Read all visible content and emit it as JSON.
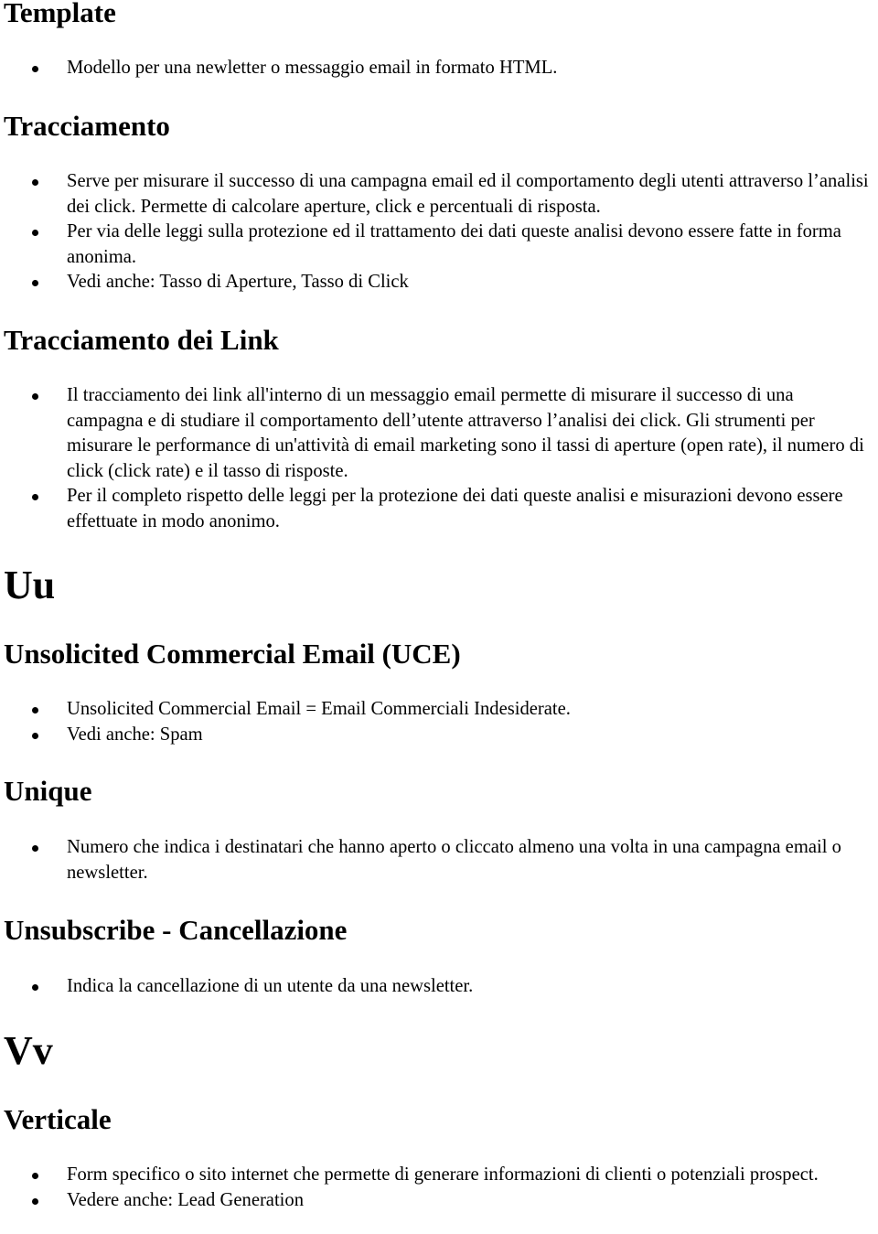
{
  "sections": [
    {
      "heading": "Template",
      "items": [
        "Modello per una newletter o messaggio email in formato HTML."
      ]
    },
    {
      "heading": "Tracciamento",
      "items": [
        "Serve per misurare il successo di una campagna email ed il comportamento degli utenti attraverso l’analisi dei click. Permette di calcolare aperture, click e percentuali di risposta.",
        "Per via delle leggi sulla protezione ed il trattamento dei dati queste analisi devono essere fatte in forma anonima.",
        "Vedi anche: Tasso di Aperture, Tasso di Click"
      ]
    },
    {
      "heading": "Tracciamento dei Link",
      "items": [
        "Il tracciamento dei link all'interno di un messaggio email permette di  misurare il successo di una campagna e di studiare il comportamento dell’utente attraverso l’analisi dei click. Gli strumenti per misurare le performance di un'attività di email marketing sono il tassi di aperture (open rate), il numero di click (click rate) e il tasso di risposte.",
        "Per il completo rispetto delle leggi per la protezione dei dati queste analisi e misurazioni devono essere effettuate in modo anonimo."
      ]
    },
    {
      "letter": "Uu"
    },
    {
      "heading": "Unsolicited Commercial Email (UCE)",
      "items": [
        "Unsolicited Commercial Email = Email Commerciali Indesiderate.",
        "Vedi anche: Spam"
      ]
    },
    {
      "heading": "Unique",
      "items": [
        "Numero che indica i destinatari che hanno aperto o cliccato almeno una volta in una campagna email o newsletter."
      ]
    },
    {
      "heading": "Unsubscribe - Cancellazione",
      "items": [
        "Indica la cancellazione di un utente da una newsletter."
      ]
    },
    {
      "letter": "Vv"
    },
    {
      "heading": "Verticale",
      "items": [
        "Form specifico o sito internet che permette di generare informazioni di clienti o potenziali prospect.",
        "Vedere anche: Lead Generation"
      ]
    }
  ]
}
